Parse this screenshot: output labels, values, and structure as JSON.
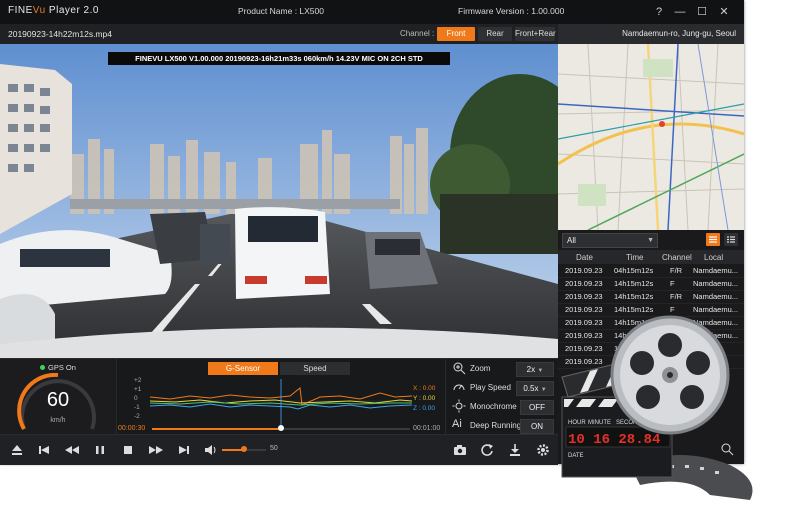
{
  "app": {
    "logo_fine": "FINE",
    "logo_vu": "Vu",
    "logo_rest": " Player 2.0",
    "product_name": "Product Name : LX500",
    "firmware_version": "Firmware Version : 1.00.000",
    "window_buttons": [
      "?",
      "—",
      "☐",
      "✕"
    ]
  },
  "file": {
    "name": "20190923-14h22m12s.mp4",
    "channel_label": "Channel :",
    "channels": [
      "Front",
      "Rear",
      "Front+Rear"
    ],
    "active_channel": "Front"
  },
  "video": {
    "osd_text": "FINEVU LX500  V1.00.000   20190923-16h21m33s  060km/h  14.23V  MIC ON 2CH STD"
  },
  "map": {
    "location": "Namdaemun-ro, Jung-gu, Seoul"
  },
  "list": {
    "filter": "All",
    "columns": [
      "Date",
      "Time",
      "Channel",
      "Local"
    ],
    "rows": [
      {
        "date": "2019.09.23",
        "time": "04h15m12s",
        "channel": "F/R",
        "local": "Namdaemu..."
      },
      {
        "date": "2019.09.23",
        "time": "14h15m12s",
        "channel": "F",
        "local": "Namdaemu..."
      },
      {
        "date": "2019.09.23",
        "time": "14h15m12s",
        "channel": "F/R",
        "local": "Namdaemu..."
      },
      {
        "date": "2019.09.23",
        "time": "14h15m12s",
        "channel": "F",
        "local": "Namdaemu..."
      },
      {
        "date": "2019.09.23",
        "time": "14h15m12s",
        "channel": "F/R",
        "local": "Namdaemu..."
      },
      {
        "date": "2019.09.23",
        "time": "14h15m12s",
        "channel": "F/R",
        "local": "Namdaemu..."
      },
      {
        "date": "2019.09.23",
        "time": "14h15m12s",
        "channel": "",
        "local": ""
      },
      {
        "date": "2019.09.23",
        "time": "",
        "channel": "",
        "local": ""
      }
    ]
  },
  "speed": {
    "gps_label": "GPS On",
    "value": "60",
    "unit": "km/h",
    "gauge_fraction": 0.5
  },
  "gsensor": {
    "tabs": [
      "G-Sensor",
      "Speed"
    ],
    "active_tab": "G-Sensor",
    "y_ticks": [
      "+2",
      "+1",
      "0",
      "-1",
      "-2"
    ],
    "x_label": "X : 0.00",
    "y_label": "Y : 0.00",
    "z_label": "Z : 0.00",
    "time_start": "00:00:30",
    "time_end": "00:01:00",
    "progress_fraction": 0.5,
    "colors": {
      "x": "#f07a1a",
      "y": "#e8d23a",
      "z": "#3aa6f0",
      "g": "#4cc46a"
    }
  },
  "settings": {
    "zoom_label": "Zoom",
    "zoom_value": "2x",
    "playspeed_label": "Play Speed",
    "playspeed_value": "0.5x",
    "mono_label": "Monochrome",
    "mono_value": "OFF",
    "deep_label": "Deep Running",
    "deep_value": "ON"
  },
  "controls": {
    "volume_value": "50",
    "volume_fraction": 0.5
  },
  "promo": {
    "clapper_labels": [
      "HOUR",
      "MINUTE",
      "SECOND"
    ],
    "clapper_digits": "10 16 28.84",
    "date_label": "DATE"
  },
  "colors": {
    "accent": "#f07a1a",
    "bg": "#1c1c1e"
  }
}
